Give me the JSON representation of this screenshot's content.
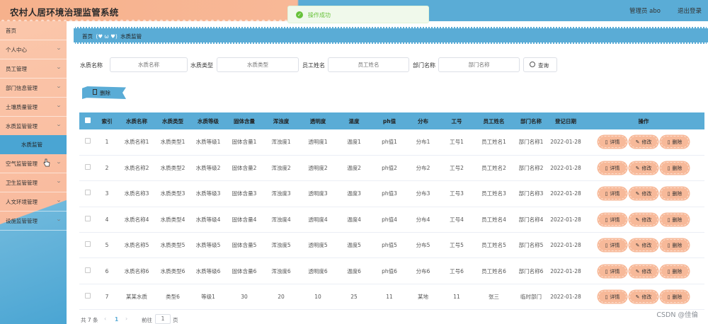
{
  "header": {
    "title": "农村人居环境治理监管系统",
    "user": "管理员 abo",
    "logout": "退出登录"
  },
  "toast": {
    "message": "操作成功"
  },
  "sidebar": {
    "items": [
      {
        "label": "首页",
        "arrow": false
      },
      {
        "label": "个人中心",
        "arrow": true
      },
      {
        "label": "员工管理",
        "arrow": true
      },
      {
        "label": "部门信息管理",
        "arrow": true
      },
      {
        "label": "土壤质量管理",
        "arrow": true
      },
      {
        "label": "水质监管管理",
        "arrow": true
      },
      {
        "label": "空气监管管理",
        "arrow": true
      },
      {
        "label": "卫生监管管理",
        "arrow": true
      },
      {
        "label": "人文环境管理",
        "arrow": true
      },
      {
        "label": "设施监管管理",
        "arrow": true
      }
    ],
    "active_sub": "水质监管"
  },
  "breadcrumb": {
    "home": "首页",
    "heart": "(♥ ω ♥)",
    "current": "水质监管"
  },
  "filters": [
    {
      "label": "水质名称",
      "placeholder": "水质名称"
    },
    {
      "label": "水质类型",
      "placeholder": "水质类型"
    },
    {
      "label": "员工姓名",
      "placeholder": "员工姓名"
    },
    {
      "label": "部门名称",
      "placeholder": "部门名称"
    }
  ],
  "search_button": "查询",
  "delete_button": "删除",
  "table": {
    "columns": [
      "索引",
      "水质名称",
      "水质类型",
      "水质等级",
      "固体含量",
      "浑浊度",
      "透明度",
      "温度",
      "ph值",
      "分布",
      "工号",
      "员工姓名",
      "部门名称",
      "登记日期",
      "操作"
    ],
    "rows": [
      [
        "1",
        "水质名称1",
        "水质类型1",
        "水质等级1",
        "固体含量1",
        "浑浊度1",
        "透明度1",
        "温度1",
        "ph值1",
        "分布1",
        "工号1",
        "员工姓名1",
        "部门名称1",
        "2022-01-28"
      ],
      [
        "2",
        "水质名称2",
        "水质类型2",
        "水质等级2",
        "固体含量2",
        "浑浊度2",
        "透明度2",
        "温度2",
        "ph值2",
        "分布2",
        "工号2",
        "员工姓名2",
        "部门名称2",
        "2022-01-28"
      ],
      [
        "3",
        "水质名称3",
        "水质类型3",
        "水质等级3",
        "固体含量3",
        "浑浊度3",
        "透明度3",
        "温度3",
        "ph值3",
        "分布3",
        "工号3",
        "员工姓名3",
        "部门名称3",
        "2022-01-28"
      ],
      [
        "4",
        "水质名称4",
        "水质类型4",
        "水质等级4",
        "固体含量4",
        "浑浊度4",
        "透明度4",
        "温度4",
        "ph值4",
        "分布4",
        "工号4",
        "员工姓名4",
        "部门名称4",
        "2022-01-28"
      ],
      [
        "5",
        "水质名称5",
        "水质类型5",
        "水质等级5",
        "固体含量5",
        "浑浊度5",
        "透明度5",
        "温度5",
        "ph值5",
        "分布5",
        "工号5",
        "员工姓名5",
        "部门名称5",
        "2022-01-28"
      ],
      [
        "6",
        "水质名称6",
        "水质类型6",
        "水质等级6",
        "固体含量6",
        "浑浊度6",
        "透明度6",
        "温度6",
        "ph值6",
        "分布6",
        "工号6",
        "员工姓名6",
        "部门名称6",
        "2022-01-28"
      ],
      [
        "7",
        "某某水质",
        "类型6",
        "等级1",
        "30",
        "20",
        "10",
        "25",
        "11",
        "某地",
        "11",
        "张三",
        "临时部门",
        "2022-01-28"
      ]
    ],
    "actions": {
      "detail": "详情",
      "edit": "修改",
      "delete": "删除"
    }
  },
  "pagination": {
    "total": "共 7 条",
    "prev": "‹",
    "page": "1",
    "next": "›",
    "goto": "前往",
    "input": "1",
    "unit": "页"
  },
  "watermark": "CSDN @佳倫",
  "colors": {
    "accent_blue": "#5aacd6",
    "accent_peach": "#f7b999",
    "success": "#67c23a"
  }
}
